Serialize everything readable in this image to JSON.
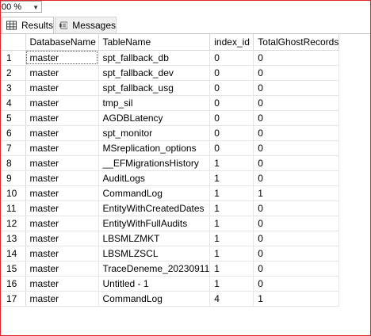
{
  "zoom": {
    "value": "00 %"
  },
  "tabs": [
    {
      "label": "Results",
      "icon": "grid-icon",
      "active": true
    },
    {
      "label": "Messages",
      "icon": "messages-icon",
      "active": false
    }
  ],
  "grid": {
    "columns": [
      "DatabaseName",
      "TableName",
      "index_id",
      "TotalGhostRecords"
    ],
    "rows": [
      [
        "1",
        "master",
        "spt_fallback_db",
        "0",
        "0"
      ],
      [
        "2",
        "master",
        "spt_fallback_dev",
        "0",
        "0"
      ],
      [
        "3",
        "master",
        "spt_fallback_usg",
        "0",
        "0"
      ],
      [
        "4",
        "master",
        "tmp_sil",
        "0",
        "0"
      ],
      [
        "5",
        "master",
        "AGDBLatency",
        "0",
        "0"
      ],
      [
        "6",
        "master",
        "spt_monitor",
        "0",
        "0"
      ],
      [
        "7",
        "master",
        "MSreplication_options",
        "0",
        "0"
      ],
      [
        "8",
        "master",
        "__EFMigrationsHistory",
        "1",
        "0"
      ],
      [
        "9",
        "master",
        "AuditLogs",
        "1",
        "0"
      ],
      [
        "10",
        "master",
        "CommandLog",
        "1",
        "1"
      ],
      [
        "11",
        "master",
        "EntityWithCreatedDates",
        "1",
        "0"
      ],
      [
        "12",
        "master",
        "EntityWithFullAudits",
        "1",
        "0"
      ],
      [
        "13",
        "master",
        "LBSMLZMKT",
        "1",
        "0"
      ],
      [
        "14",
        "master",
        "LBSMLZSCL",
        "1",
        "0"
      ],
      [
        "15",
        "master",
        "TraceDeneme_20230911",
        "1",
        "0"
      ],
      [
        "16",
        "master",
        "Untitled - 1",
        "1",
        "0"
      ],
      [
        "17",
        "master",
        "CommandLog",
        "4",
        "1"
      ]
    ]
  },
  "colors": {
    "frame_border": "#e0242a",
    "grid_line": "#e6e6e6"
  }
}
